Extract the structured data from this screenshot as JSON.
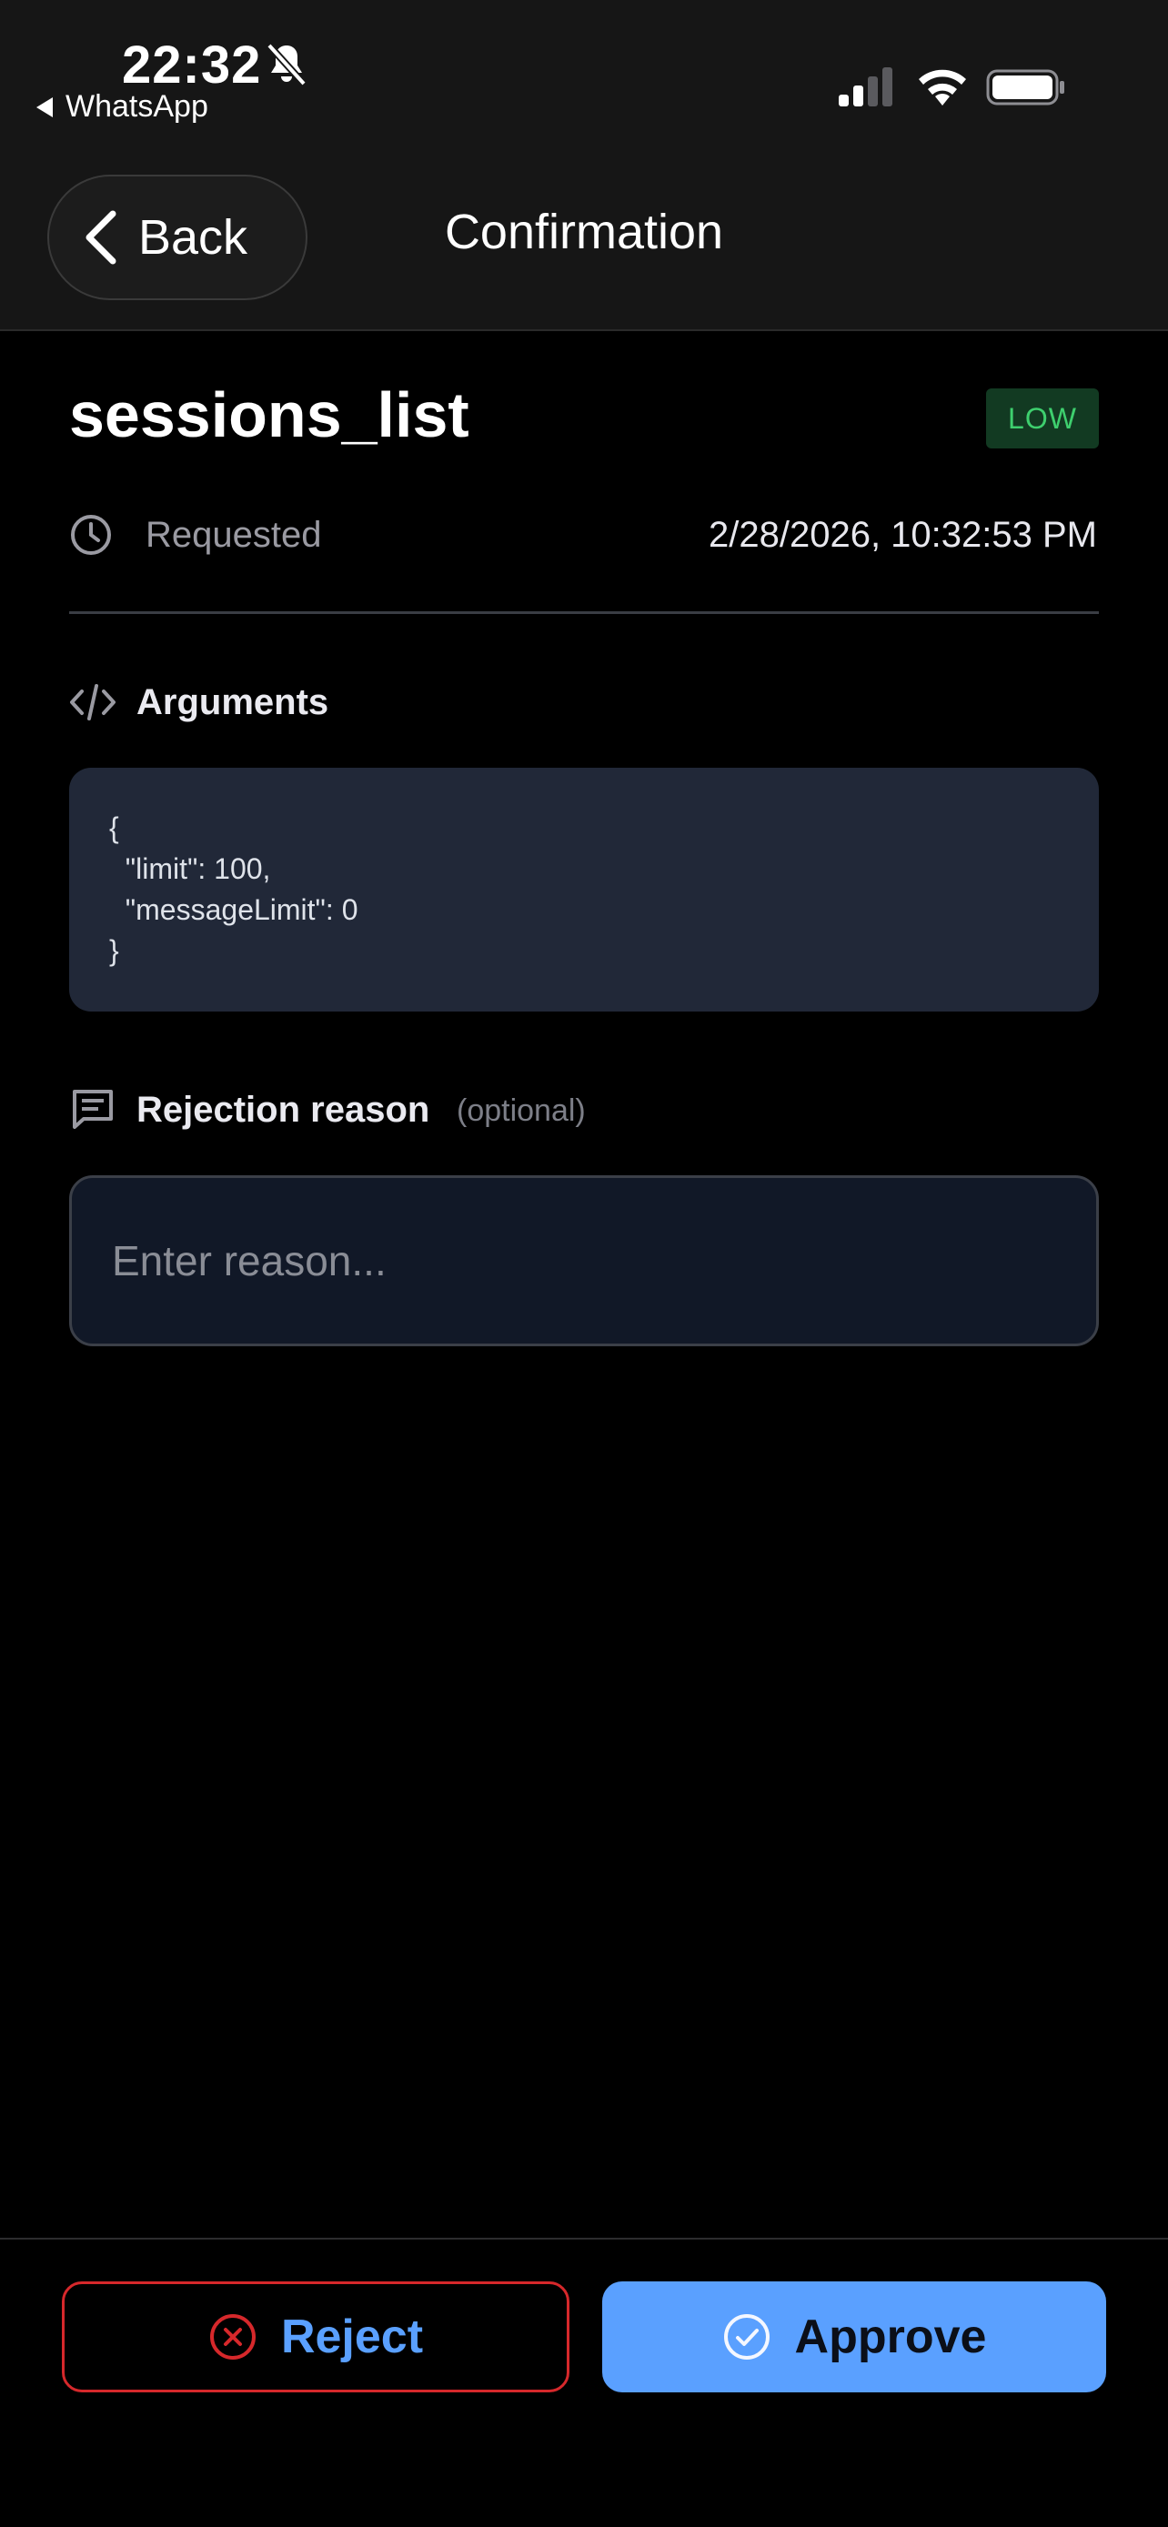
{
  "status_bar": {
    "time": "22:32",
    "back_app": "WhatsApp",
    "icons": [
      "bell-slash-icon",
      "signal-icon",
      "wifi-icon",
      "battery-icon"
    ]
  },
  "nav": {
    "back_label": "Back",
    "title": "Confirmation"
  },
  "request": {
    "tool_name": "sessions_list",
    "risk_level": "LOW",
    "requested_label": "Requested",
    "requested_time": "2/28/2026, 10:32:53 PM"
  },
  "arguments": {
    "title": "Arguments",
    "lines": [
      "{",
      "  \"limit\": 100,",
      "  \"messageLimit\": 0",
      "}"
    ]
  },
  "rejection": {
    "title": "Rejection reason",
    "optional_label": "(optional)",
    "placeholder": "Enter reason...",
    "value": ""
  },
  "actions": {
    "reject_label": "Reject",
    "approve_label": "Approve"
  },
  "colors": {
    "accent_blue": "#5aa0ff",
    "reject_border": "#d6282b",
    "badge_green": "#3ecf6e",
    "badge_bg": "#123a22",
    "code_bg": "#212838"
  }
}
